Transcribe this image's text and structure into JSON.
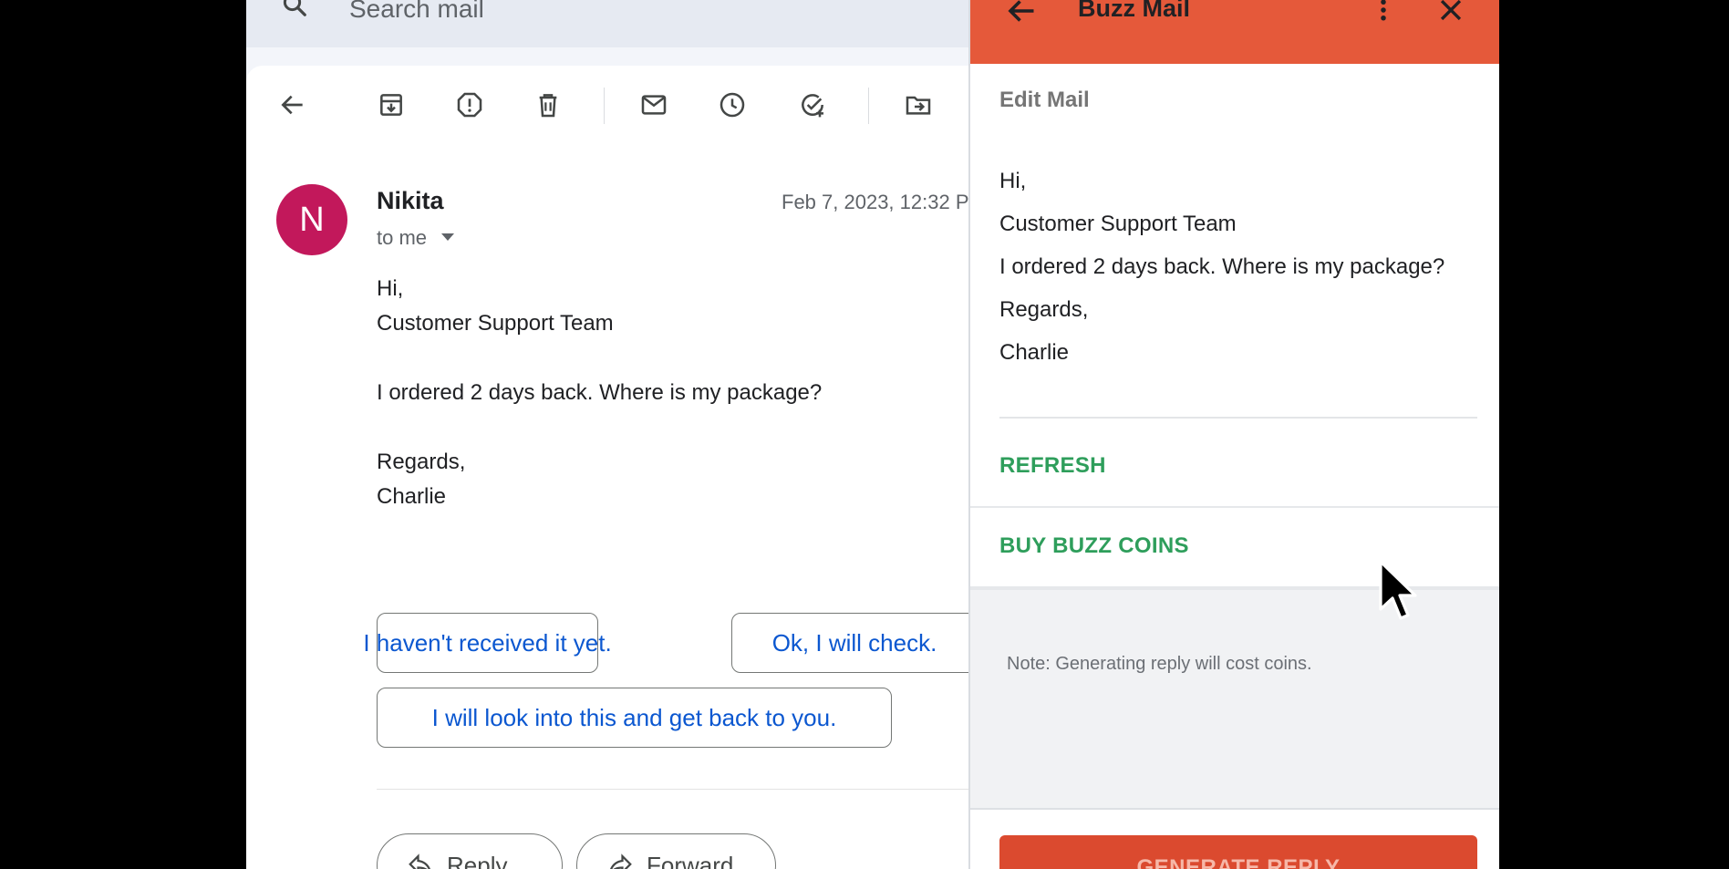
{
  "search": {
    "placeholder": "Search mail"
  },
  "toolbar": {
    "icons": [
      "back-arrow-icon",
      "archive-icon",
      "report-spam-icon",
      "delete-icon",
      "mark-unread-icon",
      "snooze-icon",
      "add-task-icon",
      "move-to-icon"
    ]
  },
  "message": {
    "avatar_letter": "N",
    "avatar_color": "#c2185b",
    "sender": "Nikita",
    "date": "Feb 7, 2023, 12:32 P",
    "to": "to me",
    "body": [
      "Hi,",
      "Customer Support Team",
      "I ordered 2 days back. Where is my package?",
      "Regards,",
      "Charlie"
    ]
  },
  "smart_replies": [
    "I haven't received it yet.",
    "Ok, I will check.",
    "I will look into this and get back to you."
  ],
  "actions": {
    "reply": "Reply",
    "forward": "Forward"
  },
  "buzz": {
    "title": "Buzz Mail",
    "header_color": "#e5593a",
    "edit_label": "Edit Mail",
    "body": [
      "Hi,",
      "Customer Support Team",
      "I ordered 2 days back. Where is my package?",
      "Regards,",
      "Charlie"
    ],
    "refresh": "REFRESH",
    "buy_coins": "BUY BUZZ COINS",
    "note": "Note: Generating reply will cost coins.",
    "generate": "GENERATE REPLY",
    "accent_green": "#2e9e5b"
  }
}
